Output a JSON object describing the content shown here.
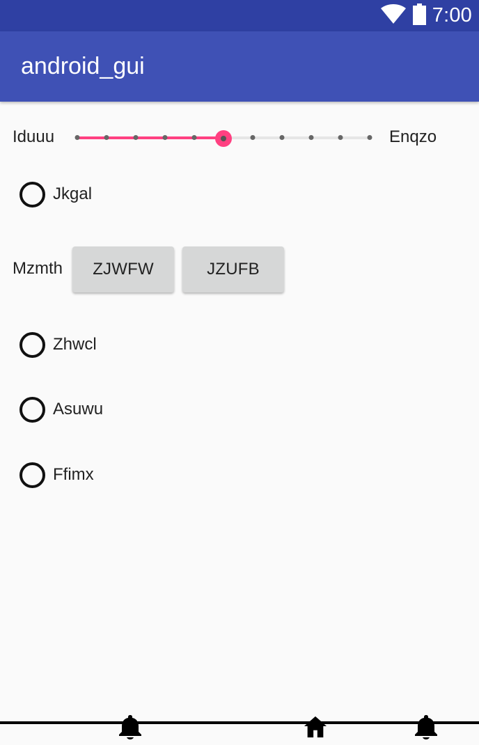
{
  "status_bar": {
    "time": "7:00",
    "icons": [
      "wifi-icon",
      "battery-icon"
    ],
    "background": "#2f40a3"
  },
  "app_bar": {
    "title": "android_gui",
    "background": "#3f51b5"
  },
  "slider": {
    "min_label": "Iduuu",
    "max_label": "Enqzo",
    "steps": 10,
    "value": 5,
    "accent": "#ff4081"
  },
  "options": {
    "jkgal": "Jkgal",
    "zhwcl": "Zhwcl",
    "asuwu": "Asuwu",
    "ffimx": "Ffimx"
  },
  "button_group": {
    "label": "Mzmth",
    "buttons": [
      "ZJWFW",
      "JZUFB"
    ]
  },
  "bottom_nav": {
    "icons": [
      "bell-icon",
      "home-icon",
      "bell-icon"
    ]
  }
}
